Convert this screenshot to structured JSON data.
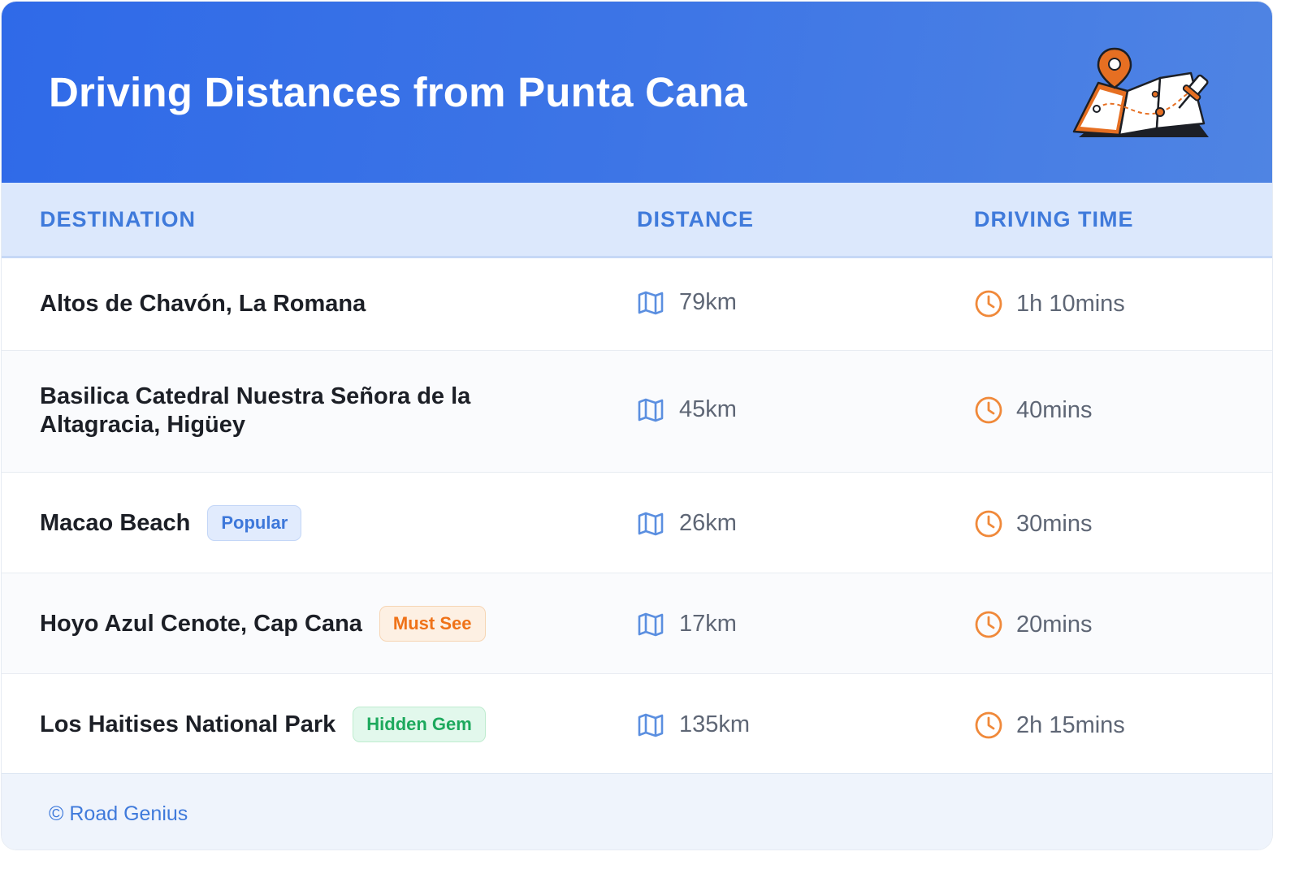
{
  "header": {
    "title": "Driving Distances from Punta Cana",
    "illustration": "map-with-pins-icon"
  },
  "table": {
    "columns": [
      "DESTINATION",
      "DISTANCE",
      "DRIVING TIME"
    ],
    "distance_icon": "map-icon",
    "time_icon": "clock-icon",
    "rows": [
      {
        "destination": "Altos de Chavón, La Romana",
        "badge": null,
        "distance": "79km",
        "time": "1h 10mins"
      },
      {
        "destination": "Basilica Catedral Nuestra Señora de la Altagracia, Higüey",
        "badge": null,
        "distance": "45km",
        "time": "40mins"
      },
      {
        "destination": "Macao Beach",
        "badge": "Popular",
        "distance": "26km",
        "time": "30mins"
      },
      {
        "destination": "Hoyo Azul Cenote, Cap Cana",
        "badge": "Must See",
        "distance": "17km",
        "time": "20mins"
      },
      {
        "destination": "Los Haitises National Park",
        "badge": "Hidden Gem",
        "distance": "135km",
        "time": "2h 15mins"
      }
    ]
  },
  "footer": {
    "credit": "© Road Genius"
  },
  "colors": {
    "header_gradient_start": "#2f6ae8",
    "header_gradient_end": "#4f84e3",
    "accent_blue": "#3f7adb",
    "accent_orange": "#ef7218",
    "accent_green": "#1da95d"
  }
}
